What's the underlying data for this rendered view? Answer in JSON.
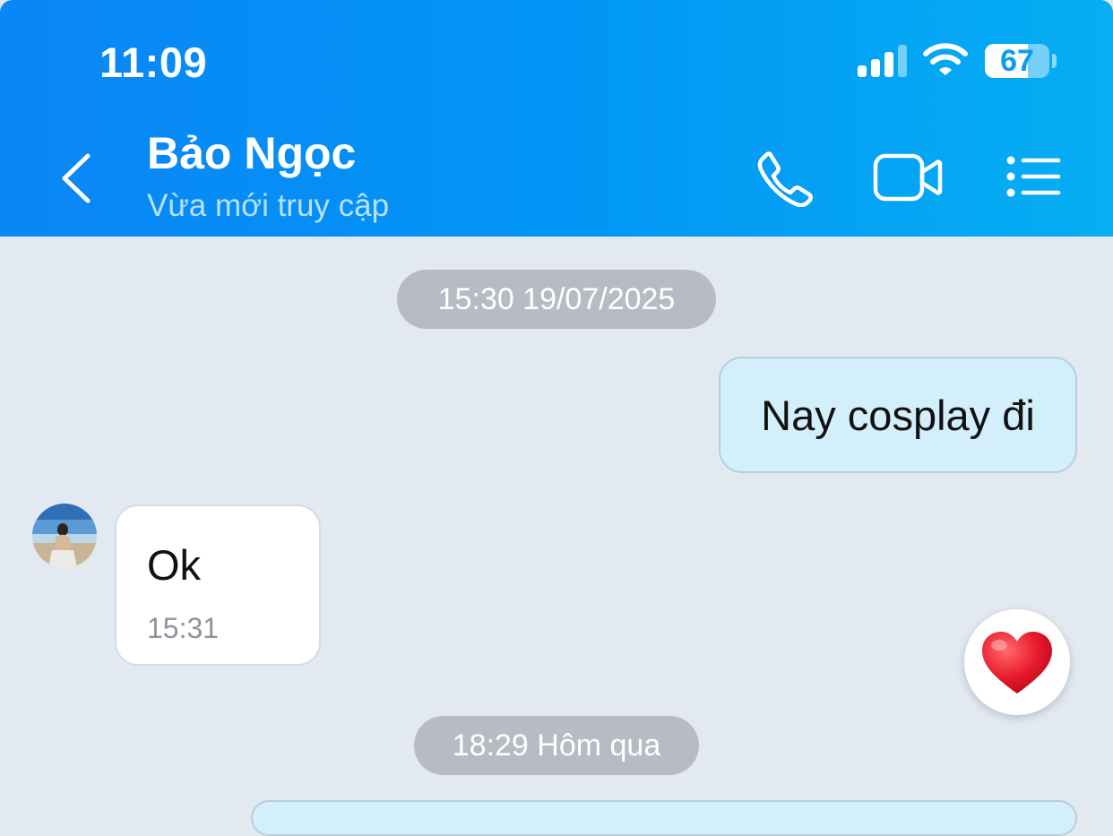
{
  "colors": {
    "header_start": "#0a86f6",
    "header_end": "#06aef3",
    "chat_background": "#e2e9f1",
    "outgoing_bubble": "#d3effc",
    "incoming_bubble": "#ffffff",
    "time_pill": "#b7bcc4",
    "heart": "#e8192c"
  },
  "status_bar": {
    "time": "11:09",
    "signal_bars_active": 3,
    "signal_bars_total": 4,
    "wifi_icon": "wifi-icon",
    "battery_percent": "67",
    "battery_level": 0.67
  },
  "header": {
    "back_icon": "chevron-left-icon",
    "contact_name": "Bảo Ngọc",
    "contact_status": "Vừa mới truy cập",
    "call_icon": "phone-icon",
    "video_icon": "video-camera-icon",
    "menu_icon": "list-menu-icon"
  },
  "chat": {
    "time_separator_1": "15:30 19/07/2025",
    "outgoing_message_1": "Nay cosplay đi",
    "incoming_message_1": "Ok",
    "incoming_message_1_time": "15:31",
    "reaction_icon": "heart-icon",
    "time_separator_2": "18:29 Hôm qua"
  }
}
